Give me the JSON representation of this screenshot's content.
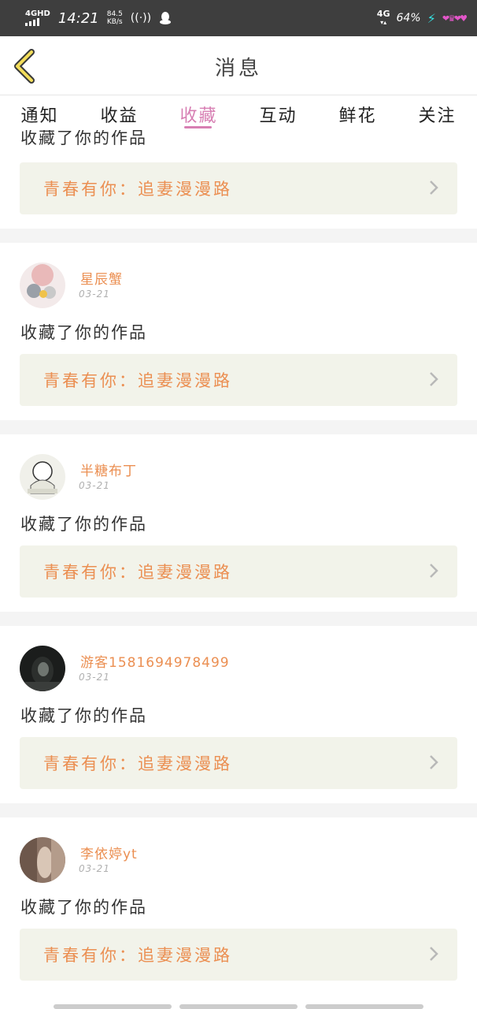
{
  "status_bar": {
    "network": "4GHD",
    "time": "14:21",
    "speed_value": "84.5",
    "speed_unit": "KB/s",
    "signal_right": "4G",
    "battery": "64%"
  },
  "header": {
    "title": "消息"
  },
  "tabs": [
    {
      "label": "通知",
      "active": false
    },
    {
      "label": "收益",
      "active": false
    },
    {
      "label": "收藏",
      "active": true
    },
    {
      "label": "互动",
      "active": false
    },
    {
      "label": "鲜花",
      "active": false
    },
    {
      "label": "关注",
      "active": false
    }
  ],
  "top_partial": {
    "action": "收藏了你的作品",
    "work_title": "青春有你：追妻漫漫路"
  },
  "items": [
    {
      "username": "星辰蟹",
      "date": "03-21",
      "action": "收藏了你的作品",
      "work_title": "青春有你：追妻漫漫路"
    },
    {
      "username": "半糖布丁",
      "date": "03-21",
      "action": "收藏了你的作品",
      "work_title": "青春有你：追妻漫漫路"
    },
    {
      "username": "游客1581694978499",
      "date": "03-21",
      "action": "收藏了你的作品",
      "work_title": "青春有你：追妻漫漫路"
    },
    {
      "username": "李依婷yt",
      "date": "03-21",
      "action": "收藏了你的作品",
      "work_title": "青春有你：追妻漫漫路"
    }
  ],
  "colors": {
    "accent_pink": "#d77fb3",
    "username_orange": "#eb8f52",
    "link_bg": "#f2f3ea",
    "status_bar_bg": "#3e3e3e"
  },
  "icons": [
    "back-chevron-icon",
    "chevron-right-icon",
    "signal-icon",
    "hotspot-icon",
    "qq-icon",
    "charging-icon"
  ]
}
